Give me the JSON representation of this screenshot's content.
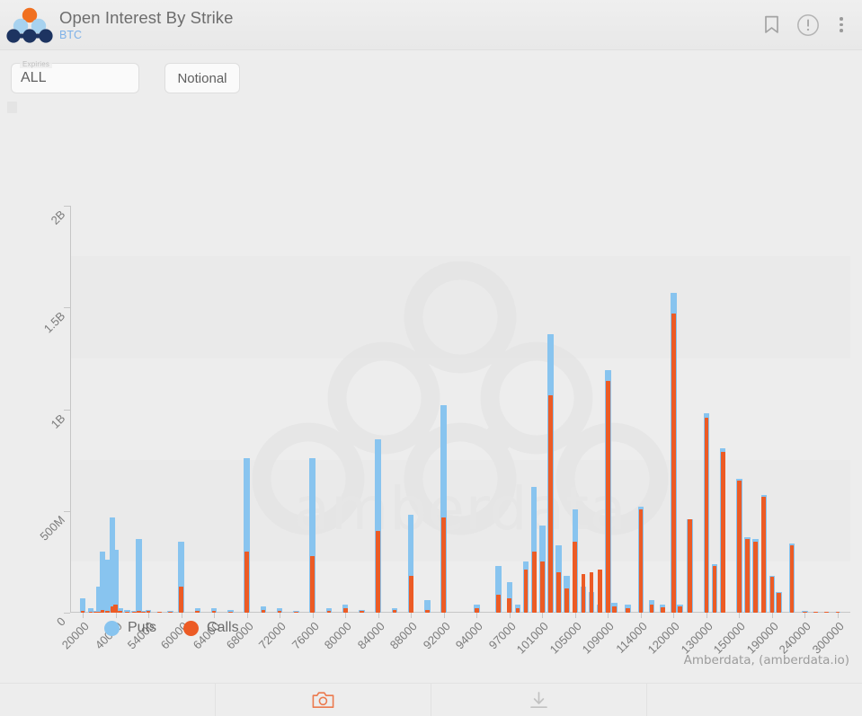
{
  "header": {
    "title": "Open Interest By Strike",
    "subtitle": "BTC",
    "logo_icon": "amberdata-logo-icon",
    "bookmark_icon": "bookmark-icon",
    "info_icon": "info-circle-icon",
    "menu_icon": "kebab-menu-icon"
  },
  "controls": {
    "expiries_label": "Expiries",
    "expiries_value": "ALL",
    "notional_label": "Notional"
  },
  "legend": {
    "puts_label": "Puts",
    "calls_label": "Calls",
    "puts_color": "#88c4ef",
    "calls_color": "#ec5b25"
  },
  "credit": "Amberdata, (amberdata.io)",
  "watermark_text": "amberdata",
  "toolbar": {
    "camera_icon": "camera-icon",
    "download_icon": "download-icon",
    "camera_color": "#ec7a4e",
    "download_color": "#c2c2c2"
  },
  "chart_data": {
    "type": "bar",
    "title": "Open Interest By Strike",
    "subtitle": "BTC",
    "xlabel": "",
    "ylabel": "",
    "ylim": [
      0,
      2000000000
    ],
    "ytick_values": [
      0,
      500000000,
      1000000000,
      1500000000,
      2000000000
    ],
    "ytick_labels": [
      "0",
      "500M",
      "1B",
      "1.5B",
      "2B"
    ],
    "grid": false,
    "legend_position": "bottom-left",
    "bar_overlay": "overlaid",
    "categories": [
      "20000",
      "40000",
      "54000",
      "60000",
      "64000",
      "68000",
      "72000",
      "76000",
      "80000",
      "84000",
      "88000",
      "92000",
      "94000",
      "97000",
      "101000",
      "105000",
      "109000",
      "114000",
      "120000",
      "130000",
      "150000",
      "190000",
      "240000",
      "300000"
    ],
    "x_positions": [
      22500,
      38000,
      48000,
      55000,
      62000,
      68000,
      74000,
      80000,
      86000,
      90000,
      92000,
      94000,
      95000,
      97000,
      101000,
      105000,
      109000,
      114000,
      120000,
      130000,
      150000,
      190000,
      240000,
      300000
    ],
    "series": [
      {
        "name": "Puts",
        "color": "#88c4ef",
        "strikes": [
          20000,
          25000,
          28000,
          30000,
          32000,
          35000,
          38000,
          40000,
          42000,
          45000,
          48000,
          50000,
          52000,
          54000,
          56000,
          58000,
          60000,
          62000,
          64000,
          66000,
          68000,
          70000,
          72000,
          74000,
          76000,
          78000,
          80000,
          82000,
          84000,
          86000,
          88000,
          90000,
          92000,
          94000,
          96000,
          97000,
          98000,
          99000,
          100000,
          101000,
          102000,
          103000,
          104000,
          105000,
          106000,
          107000,
          108000,
          109000,
          110000,
          112000,
          114000,
          116000,
          118000,
          120000,
          122000,
          125000,
          130000,
          135000,
          140000,
          150000,
          160000,
          170000,
          180000,
          190000,
          200000,
          220000,
          240000,
          260000,
          280000,
          300000
        ],
        "values": [
          70000000,
          20000000,
          10000000,
          130000000,
          300000000,
          260000000,
          470000000,
          310000000,
          20000000,
          15000000,
          10000000,
          360000000,
          10000000,
          12000000,
          5000000,
          8000000,
          350000000,
          20000000,
          20000000,
          15000000,
          760000000,
          30000000,
          20000000,
          10000000,
          760000000,
          20000000,
          40000000,
          15000000,
          850000000,
          20000000,
          480000000,
          60000000,
          1020000000,
          40000000,
          230000000,
          150000000,
          40000000,
          250000000,
          620000000,
          430000000,
          1370000000,
          330000000,
          180000000,
          510000000,
          130000000,
          100000000,
          40000000,
          1190000000,
          50000000,
          40000000,
          520000000,
          60000000,
          40000000,
          1570000000,
          40000000,
          460000000,
          980000000,
          240000000,
          810000000,
          660000000,
          370000000,
          360000000,
          580000000,
          180000000,
          100000000,
          340000000,
          8000000,
          6000000,
          5000000,
          4000000
        ]
      },
      {
        "name": "Calls",
        "color": "#ec5b25",
        "strikes": [
          20000,
          25000,
          28000,
          30000,
          32000,
          35000,
          38000,
          40000,
          42000,
          45000,
          48000,
          50000,
          52000,
          54000,
          56000,
          58000,
          60000,
          62000,
          64000,
          66000,
          68000,
          70000,
          72000,
          74000,
          76000,
          78000,
          80000,
          82000,
          84000,
          86000,
          88000,
          90000,
          92000,
          94000,
          96000,
          97000,
          98000,
          99000,
          100000,
          101000,
          102000,
          103000,
          104000,
          105000,
          106000,
          107000,
          108000,
          109000,
          110000,
          112000,
          114000,
          116000,
          118000,
          120000,
          122000,
          125000,
          130000,
          135000,
          140000,
          150000,
          160000,
          170000,
          180000,
          190000,
          200000,
          220000,
          240000,
          260000,
          280000,
          300000
        ],
        "values": [
          8000000,
          6000000,
          5000000,
          6000000,
          12000000,
          10000000,
          30000000,
          40000000,
          8000000,
          6000000,
          5000000,
          10000000,
          6000000,
          8000000,
          5000000,
          6000000,
          130000000,
          10000000,
          8000000,
          6000000,
          300000000,
          12000000,
          10000000,
          6000000,
          280000000,
          10000000,
          20000000,
          8000000,
          400000000,
          12000000,
          180000000,
          15000000,
          470000000,
          20000000,
          90000000,
          70000000,
          20000000,
          210000000,
          300000000,
          250000000,
          1070000000,
          200000000,
          120000000,
          350000000,
          190000000,
          200000000,
          210000000,
          1140000000,
          30000000,
          20000000,
          510000000,
          40000000,
          25000000,
          1470000000,
          30000000,
          460000000,
          960000000,
          230000000,
          790000000,
          650000000,
          360000000,
          350000000,
          570000000,
          175000000,
          95000000,
          330000000,
          6000000,
          5000000,
          4000000,
          3000000
        ]
      }
    ]
  }
}
